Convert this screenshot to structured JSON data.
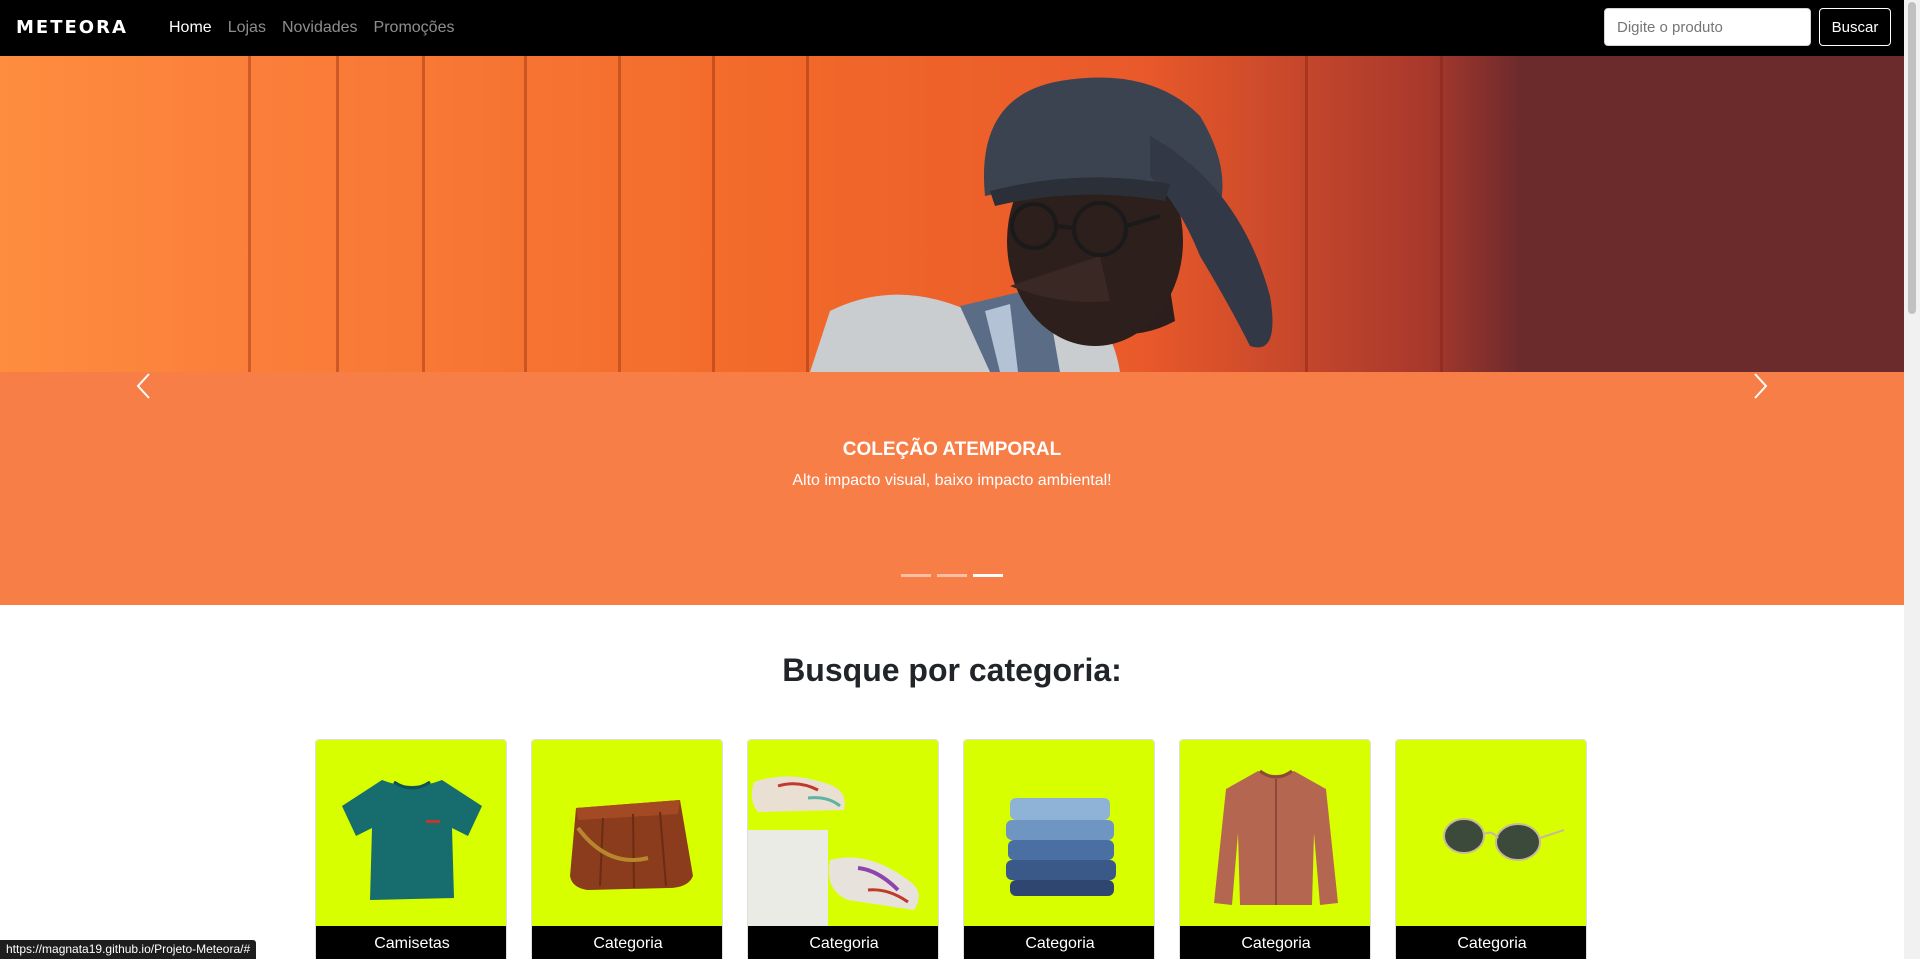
{
  "navbar": {
    "logo": "METEORA",
    "links": [
      {
        "label": "Home",
        "active": true
      },
      {
        "label": "Lojas",
        "active": false
      },
      {
        "label": "Novidades",
        "active": false
      },
      {
        "label": "Promoções",
        "active": false
      }
    ],
    "search_placeholder": "Digite o produto",
    "search_button": "Buscar"
  },
  "hero": {
    "title": "COLEÇÃO ATEMPORAL",
    "subtitle": "Alto impacto visual, baixo impacto ambiental!",
    "slides_count": 3,
    "active_slide": 3,
    "colors": {
      "caption_bg": "#f87e48"
    }
  },
  "categories": {
    "heading": "Busque por categoria:",
    "items": [
      {
        "label": "Camisetas",
        "icon": "tshirt-icon"
      },
      {
        "label": "Categoria",
        "icon": "bag-icon"
      },
      {
        "label": "Categoria",
        "icon": "sneakers-icon"
      },
      {
        "label": "Categoria",
        "icon": "jeans-icon"
      },
      {
        "label": "Categoria",
        "icon": "jacket-icon"
      },
      {
        "label": "Categoria",
        "icon": "sunglasses-icon"
      }
    ],
    "colors": {
      "card_bg": "#d8ff00",
      "label_bg": "#000000"
    }
  },
  "statusbar": {
    "url": "https://magnata19.github.io/Projeto-Meteora/#"
  }
}
